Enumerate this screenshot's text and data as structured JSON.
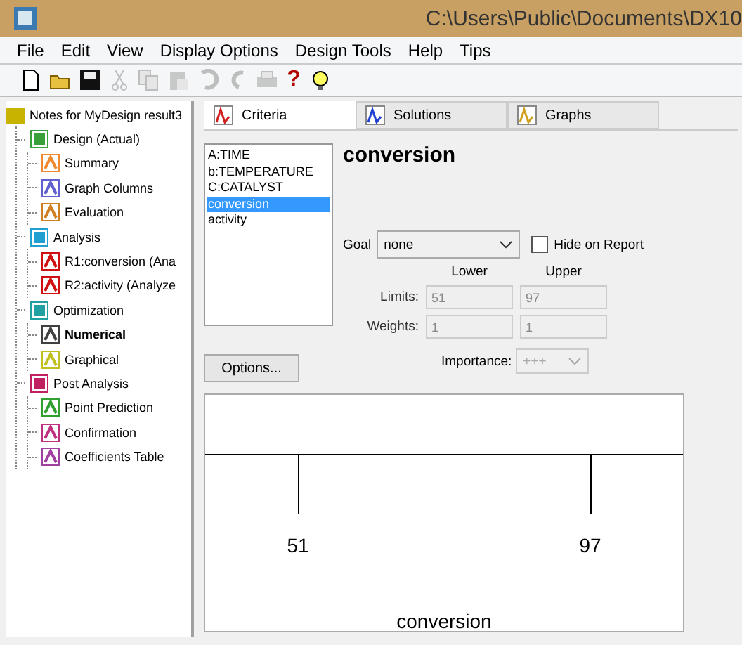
{
  "window": {
    "title": "C:\\Users\\Public\\Documents\\DX10"
  },
  "menu": [
    "File",
    "Edit",
    "View",
    "Display Options",
    "Design Tools",
    "Help",
    "Tips"
  ],
  "toolbar": [
    {
      "kind": "new",
      "disabled": false
    },
    {
      "kind": "open",
      "disabled": false
    },
    {
      "kind": "save",
      "disabled": false
    },
    {
      "kind": "cut",
      "disabled": true
    },
    {
      "kind": "copy",
      "disabled": true
    },
    {
      "kind": "paste",
      "disabled": true
    },
    {
      "kind": "undo",
      "disabled": true
    },
    {
      "kind": "redo",
      "disabled": true
    },
    {
      "kind": "print",
      "disabled": true
    },
    {
      "kind": "help",
      "disabled": false,
      "glyph": "?"
    },
    {
      "kind": "tip",
      "disabled": false
    }
  ],
  "tree": [
    {
      "label": "Notes for MyDesign result3",
      "kind": "folder",
      "selected": false,
      "children": [
        {
          "label": "Design (Actual)",
          "kind": "grid",
          "selected": false,
          "children": [
            {
              "label": "Summary",
              "kind": "sheet",
              "selected": false
            },
            {
              "label": "Graph Columns",
              "kind": "graph",
              "selected": false
            },
            {
              "label": "Evaluation",
              "kind": "search",
              "selected": false
            }
          ]
        },
        {
          "label": "Analysis",
          "kind": "table",
          "selected": false,
          "children": [
            {
              "label": "R1:conversion (Ana",
              "kind": "response",
              "selected": false
            },
            {
              "label": "R2:activity (Analyze",
              "kind": "response",
              "selected": false
            }
          ]
        },
        {
          "label": "Optimization",
          "kind": "mountain",
          "selected": false,
          "children": [
            {
              "label": "Numerical",
              "kind": "numeric",
              "selected": true
            },
            {
              "label": "Graphical",
              "kind": "graphic",
              "selected": false
            }
          ]
        },
        {
          "label": "Post Analysis",
          "kind": "check",
          "selected": false,
          "children": [
            {
              "label": "Point Prediction",
              "kind": "point",
              "selected": false
            },
            {
              "label": "Confirmation",
              "kind": "confirm",
              "selected": false
            },
            {
              "label": "Coefficients Table",
              "kind": "coef",
              "selected": false
            }
          ]
        }
      ]
    }
  ],
  "tabs": [
    {
      "label": "Criteria",
      "kind": "peak",
      "selected": true
    },
    {
      "label": "Solutions",
      "kind": "curve",
      "selected": false
    },
    {
      "label": "Graphs",
      "kind": "contour",
      "selected": false
    }
  ],
  "factors": [
    {
      "label": "A:TIME",
      "selected": false
    },
    {
      "label": "b:TEMPERATURE",
      "selected": false
    },
    {
      "label": "C:CATALYST",
      "selected": false
    },
    {
      "label": "conversion",
      "selected": true
    },
    {
      "label": "activity",
      "selected": false
    }
  ],
  "heading": "conversion",
  "goal": {
    "label": "Goal",
    "value": "none"
  },
  "hide_on_report": {
    "label": "Hide on Report",
    "checked": false
  },
  "columns": [
    "Lower",
    "Upper"
  ],
  "limits": {
    "label": "Limits:",
    "lower": "51",
    "upper": "97",
    "disabled": true
  },
  "weights": {
    "label": "Weights:",
    "lower": "1",
    "upper": "1",
    "disabled": true
  },
  "options_button": "Options...",
  "importance": {
    "label": "Importance:",
    "value": "+++",
    "disabled": true
  },
  "ramp": {
    "low": "51",
    "high": "97",
    "axis_label": "conversion"
  }
}
